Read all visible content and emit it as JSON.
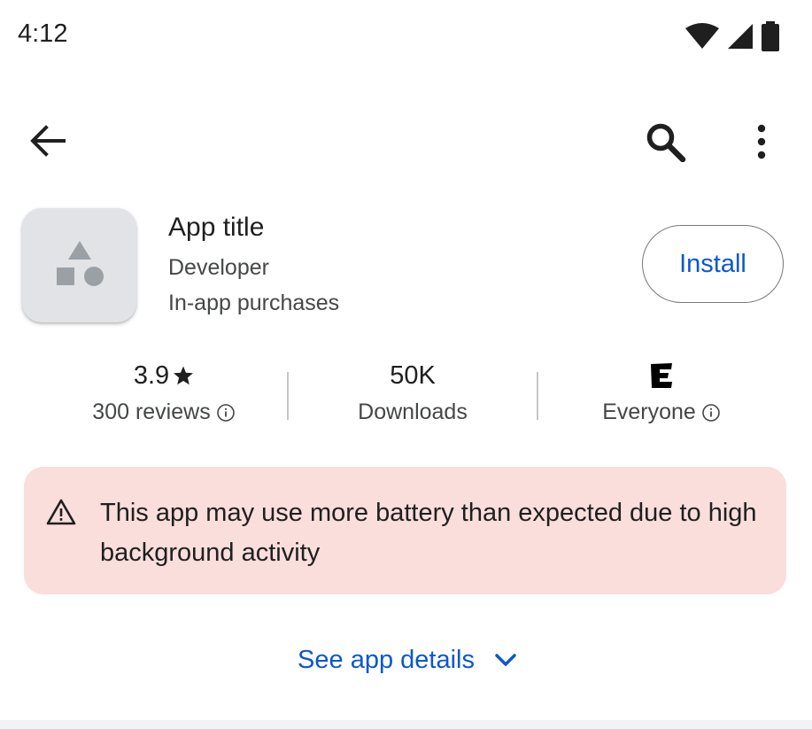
{
  "status_bar": {
    "time": "4:12",
    "icons": [
      "wifi-icon",
      "cellular-signal-icon",
      "battery-icon"
    ]
  },
  "top_bar": {
    "icons": [
      "back-arrow-icon",
      "search-icon",
      "more-vertical-icon"
    ]
  },
  "app": {
    "title": "App title",
    "developer": "Developer",
    "in_app_purchases": "In-app purchases",
    "install_label": "Install",
    "icon": "shapes-placeholder-icon"
  },
  "stats": {
    "rating_value": "3.9",
    "rating_icon": "star-icon",
    "reviews_label": "300 reviews",
    "downloads_value": "50K",
    "downloads_label": "Downloads",
    "content_rating_icon": "esrb-everyone-icon",
    "content_rating_label": "Everyone",
    "info_icon": "info-icon"
  },
  "warning": {
    "icon": "warning-triangle-icon",
    "text": "This app may use more battery than expected due to high background activity"
  },
  "details": {
    "label": "See app details",
    "icon": "chevron-down-icon"
  },
  "colors": {
    "accent": "#0b57d0",
    "warning_bg": "#f9dedc",
    "text_primary": "#1f1f1f",
    "text_secondary": "#444746"
  }
}
